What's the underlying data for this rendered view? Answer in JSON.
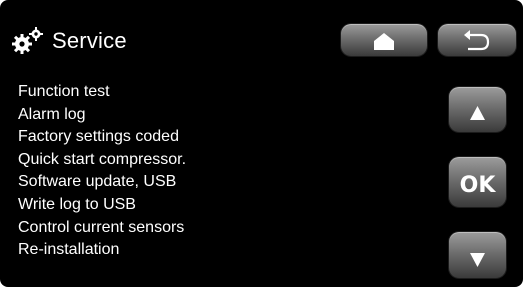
{
  "header": {
    "title": "Service",
    "icon": "gears-icon"
  },
  "nav": {
    "home_icon": "home-icon",
    "back_icon": "back-arrow-icon"
  },
  "menu": {
    "items": [
      "Function test",
      "Alarm log",
      "Factory settings coded",
      "Quick start compressor.",
      "Software update, USB",
      "Write log to USB",
      "Control current sensors",
      "Re-installation"
    ]
  },
  "controls": {
    "up_icon": "triangle-up-icon",
    "ok_label": "OK",
    "down_icon": "triangle-down-icon"
  },
  "colors": {
    "background": "#000000",
    "text": "#ffffff",
    "button": "#6e6e6e"
  }
}
